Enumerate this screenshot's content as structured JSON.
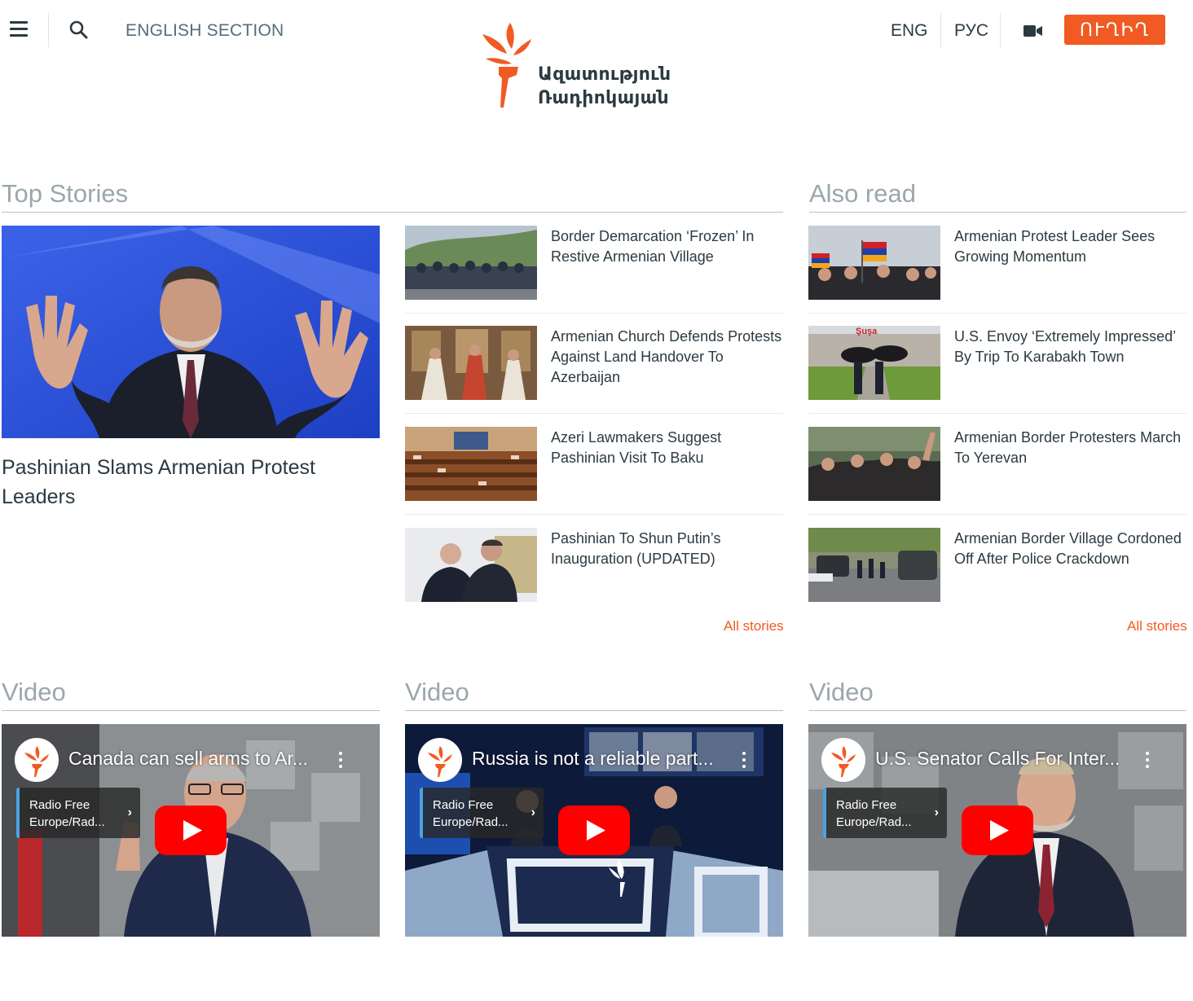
{
  "header": {
    "english_section": "ENGLISH SECTION",
    "logo_line1": "Ազատություն",
    "logo_line2": "Ռադիոկայան",
    "lang_eng": "ENG",
    "lang_rus": "РУС",
    "live_label": "ՈՒՂԻՂ",
    "accent_color": "#f15a22"
  },
  "top_stories": {
    "heading": "Top Stories",
    "feature": {
      "title": "Pashinian Slams Armenian Protest Leaders"
    },
    "items": [
      {
        "title": "Border Demarcation ‘Frozen’ In Restive Armenian Village"
      },
      {
        "title": "Armenian Church Defends Protests Against Land Handover To Azerbaijan"
      },
      {
        "title": "Azeri Lawmakers Suggest Pashinian Visit To Baku"
      },
      {
        "title": "Pashinian To Shun Putin’s Inauguration (UPDATED)"
      }
    ],
    "all_stories": "All stories"
  },
  "also_read": {
    "heading": "Also read",
    "items": [
      {
        "title": "Armenian Protest Leader Sees Growing Momentum"
      },
      {
        "title": "U.S. Envoy ‘Extremely Impressed’ By Trip To Karabakh Town"
      },
      {
        "title": "Armenian Border Protesters March To Yerevan"
      },
      {
        "title": "Armenian Border Village Cordoned Off After Police Crackdown"
      }
    ],
    "all_stories": "All stories"
  },
  "videos": [
    {
      "heading": "Video",
      "title": "Canada can sell arms to Ar...",
      "channel": "Radio Free Europe/Rad..."
    },
    {
      "heading": "Video",
      "title": "Russia is not a reliable part...",
      "channel": "Radio Free Europe/Rad..."
    },
    {
      "heading": "Video",
      "title": "U.S. Senator Calls For Inter...",
      "channel": "Radio Free Europe/Rad..."
    }
  ]
}
